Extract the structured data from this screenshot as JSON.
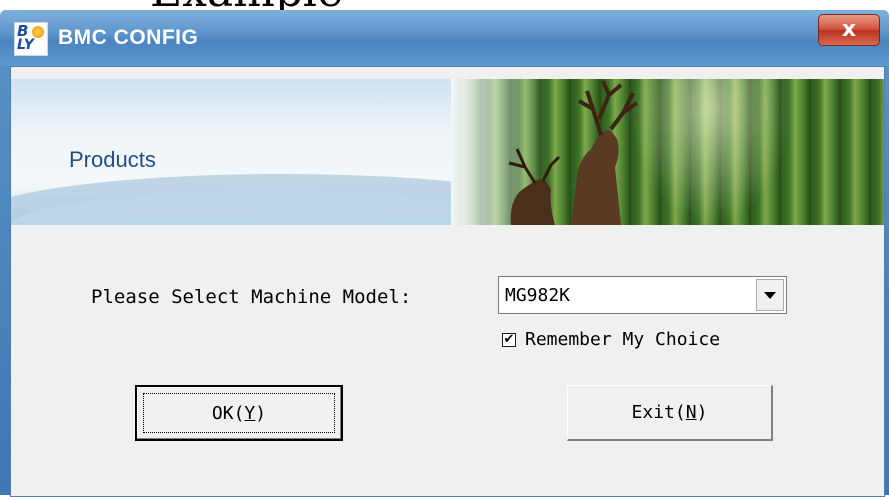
{
  "cropped_top_text": "Example",
  "window": {
    "title": "BMC CONFIG",
    "icon": "bly-app-icon",
    "close_label": "x"
  },
  "banner": {
    "title": "Products"
  },
  "form": {
    "model_label": "Please Select Machine Model:",
    "model_selected": "MG982K",
    "remember_label": "Remember My Choice",
    "remember_checked": true
  },
  "buttons": {
    "ok_label": "OK",
    "ok_mnemonic": "Y",
    "exit_label": "Exit",
    "exit_mnemonic": "N"
  },
  "colors": {
    "title_bar": "#5b93c9",
    "close_button": "#d0533c",
    "client_bg": "#f0f0f0",
    "banner_title": "#1f4f86"
  }
}
